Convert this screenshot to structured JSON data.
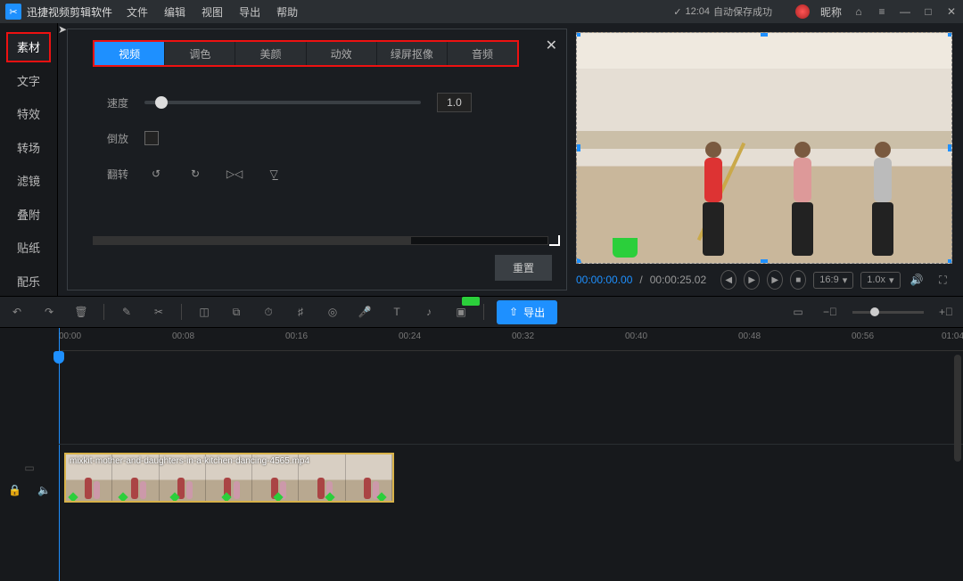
{
  "titlebar": {
    "appname": "迅捷视频剪辑软件",
    "menu": [
      "文件",
      "编辑",
      "视图",
      "导出",
      "帮助"
    ],
    "status_time": "12:04",
    "status_text": "自动保存成功",
    "nickname": "昵称"
  },
  "sidebar": {
    "items": [
      "素材",
      "文字",
      "特效",
      "转场",
      "滤镜",
      "叠附",
      "贴纸",
      "配乐"
    ]
  },
  "panel": {
    "tabs": [
      "视频",
      "调色",
      "美颜",
      "动效",
      "绿屏抠像",
      "音频"
    ],
    "speed_label": "速度",
    "speed_value": "1.0",
    "reverse_label": "倒放",
    "flip_label": "翻转",
    "reset_label": "重置"
  },
  "preview": {
    "current_time": "00:00:00.00",
    "total_time": "00:00:25.02",
    "ratio": "16:9",
    "rate": "1.0x"
  },
  "toolbar": {
    "export_label": "导出"
  },
  "ruler": {
    "ticks": [
      "00:00",
      "00:08",
      "00:16",
      "00:24",
      "00:32",
      "00:40",
      "00:48",
      "00:56",
      "01:04"
    ]
  },
  "clip": {
    "name": "mixkit-mother-and-daughters-in-a-kitchen-dancing-4565.mp4"
  }
}
